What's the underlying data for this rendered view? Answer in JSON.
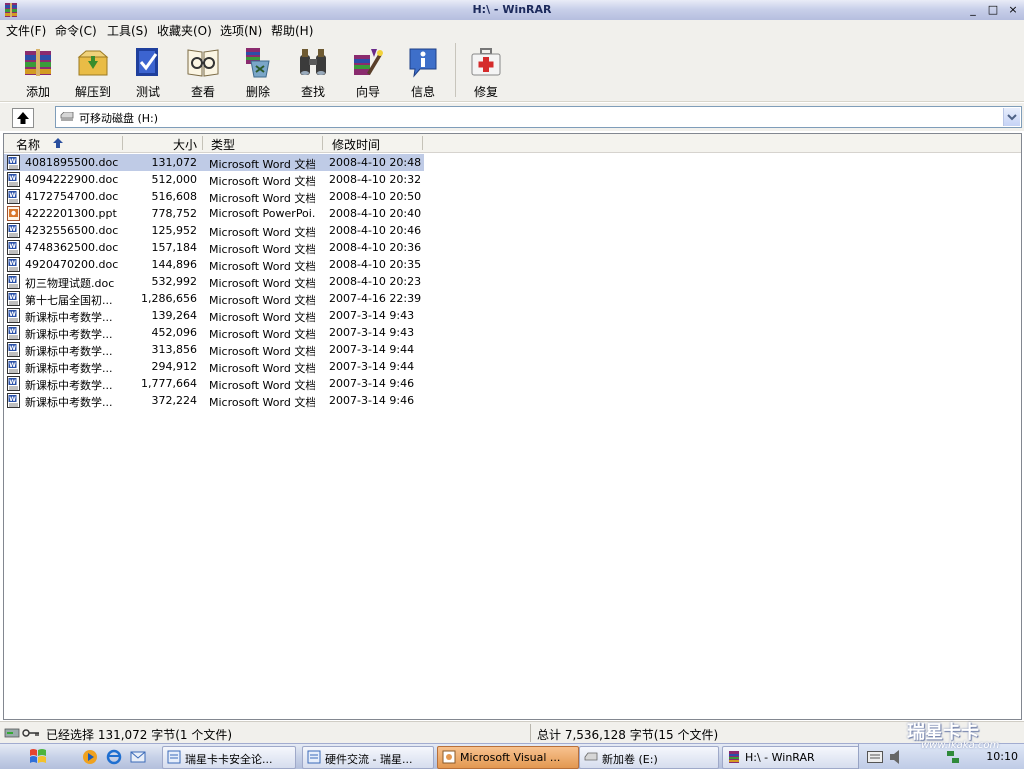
{
  "window": {
    "title": "H:\\ - WinRAR",
    "min": "_",
    "max": "□",
    "close": "×"
  },
  "menu": [
    "文件(F)",
    "命令(C)",
    "工具(S)",
    "收藏夹(O)",
    "选项(N)",
    "帮助(H)"
  ],
  "toolbar": {
    "add": "添加",
    "extract": "解压到",
    "test": "测试",
    "view": "查看",
    "delete": "删除",
    "find": "查找",
    "wizard": "向导",
    "info": "信息",
    "repair": "修复"
  },
  "address": {
    "value": "可移动磁盘 (H:)"
  },
  "columns": {
    "name": "名称",
    "size": "大小",
    "type": "类型",
    "modified": "修改时间"
  },
  "files": [
    {
      "name": "4081895500.doc",
      "size": "131,072",
      "type": "Microsoft Word 文档",
      "modified": "2008-4-10 20:48",
      "kind": "word",
      "selected": true
    },
    {
      "name": "4094222900.doc",
      "size": "512,000",
      "type": "Microsoft Word 文档",
      "modified": "2008-4-10 20:32",
      "kind": "word"
    },
    {
      "name": "4172754700.doc",
      "size": "516,608",
      "type": "Microsoft Word 文档",
      "modified": "2008-4-10 20:50",
      "kind": "word"
    },
    {
      "name": "4222201300.ppt",
      "size": "778,752",
      "type": "Microsoft PowerPoi...",
      "modified": "2008-4-10 20:40",
      "kind": "ppt"
    },
    {
      "name": "4232556500.doc",
      "size": "125,952",
      "type": "Microsoft Word 文档",
      "modified": "2008-4-10 20:46",
      "kind": "word"
    },
    {
      "name": "4748362500.doc",
      "size": "157,184",
      "type": "Microsoft Word 文档",
      "modified": "2008-4-10 20:36",
      "kind": "word"
    },
    {
      "name": "4920470200.doc",
      "size": "144,896",
      "type": "Microsoft Word 文档",
      "modified": "2008-4-10 20:35",
      "kind": "word"
    },
    {
      "name": "初三物理试题.doc",
      "size": "532,992",
      "type": "Microsoft Word 文档",
      "modified": "2008-4-10 20:23",
      "kind": "word"
    },
    {
      "name": "第十七届全国初...",
      "size": "1,286,656",
      "type": "Microsoft Word 文档",
      "modified": "2007-4-16 22:39",
      "kind": "word"
    },
    {
      "name": "新课标中考数学...",
      "size": "139,264",
      "type": "Microsoft Word 文档",
      "modified": "2007-3-14 9:43",
      "kind": "word"
    },
    {
      "name": "新课标中考数学...",
      "size": "452,096",
      "type": "Microsoft Word 文档",
      "modified": "2007-3-14 9:43",
      "kind": "word"
    },
    {
      "name": "新课标中考数学...",
      "size": "313,856",
      "type": "Microsoft Word 文档",
      "modified": "2007-3-14 9:44",
      "kind": "word"
    },
    {
      "name": "新课标中考数学...",
      "size": "294,912",
      "type": "Microsoft Word 文档",
      "modified": "2007-3-14 9:44",
      "kind": "word"
    },
    {
      "name": "新课标中考数学...",
      "size": "1,777,664",
      "type": "Microsoft Word 文档",
      "modified": "2007-3-14 9:46",
      "kind": "word"
    },
    {
      "name": "新课标中考数学...",
      "size": "372,224",
      "type": "Microsoft Word 文档",
      "modified": "2007-3-14 9:46",
      "kind": "word"
    }
  ],
  "status": {
    "left": "已经选择 131,072 字节(1 个文件)",
    "right": "总计 7,536,128 字节(15 个文件)"
  },
  "taskbar": {
    "items": [
      {
        "label": "瑞星卡卡安全论...",
        "icon": "ie-icon",
        "active": false
      },
      {
        "label": "硬件交流 - 瑞星...",
        "icon": "ie-icon",
        "active": false
      },
      {
        "label": "Microsoft Visual ...",
        "icon": "vs-icon",
        "active": true
      },
      {
        "label": "新加卷 (E:)",
        "icon": "drive-icon",
        "active": false
      },
      {
        "label": "H:\\ - WinRAR",
        "icon": "winrar-icon",
        "active": false
      }
    ],
    "clock": "10:10"
  },
  "watermark": {
    "brand": "瑞星卡卡",
    "url": "www.ikaka.com"
  },
  "colors": {
    "selection": "#bfcbe6",
    "accent": "#245edb"
  }
}
